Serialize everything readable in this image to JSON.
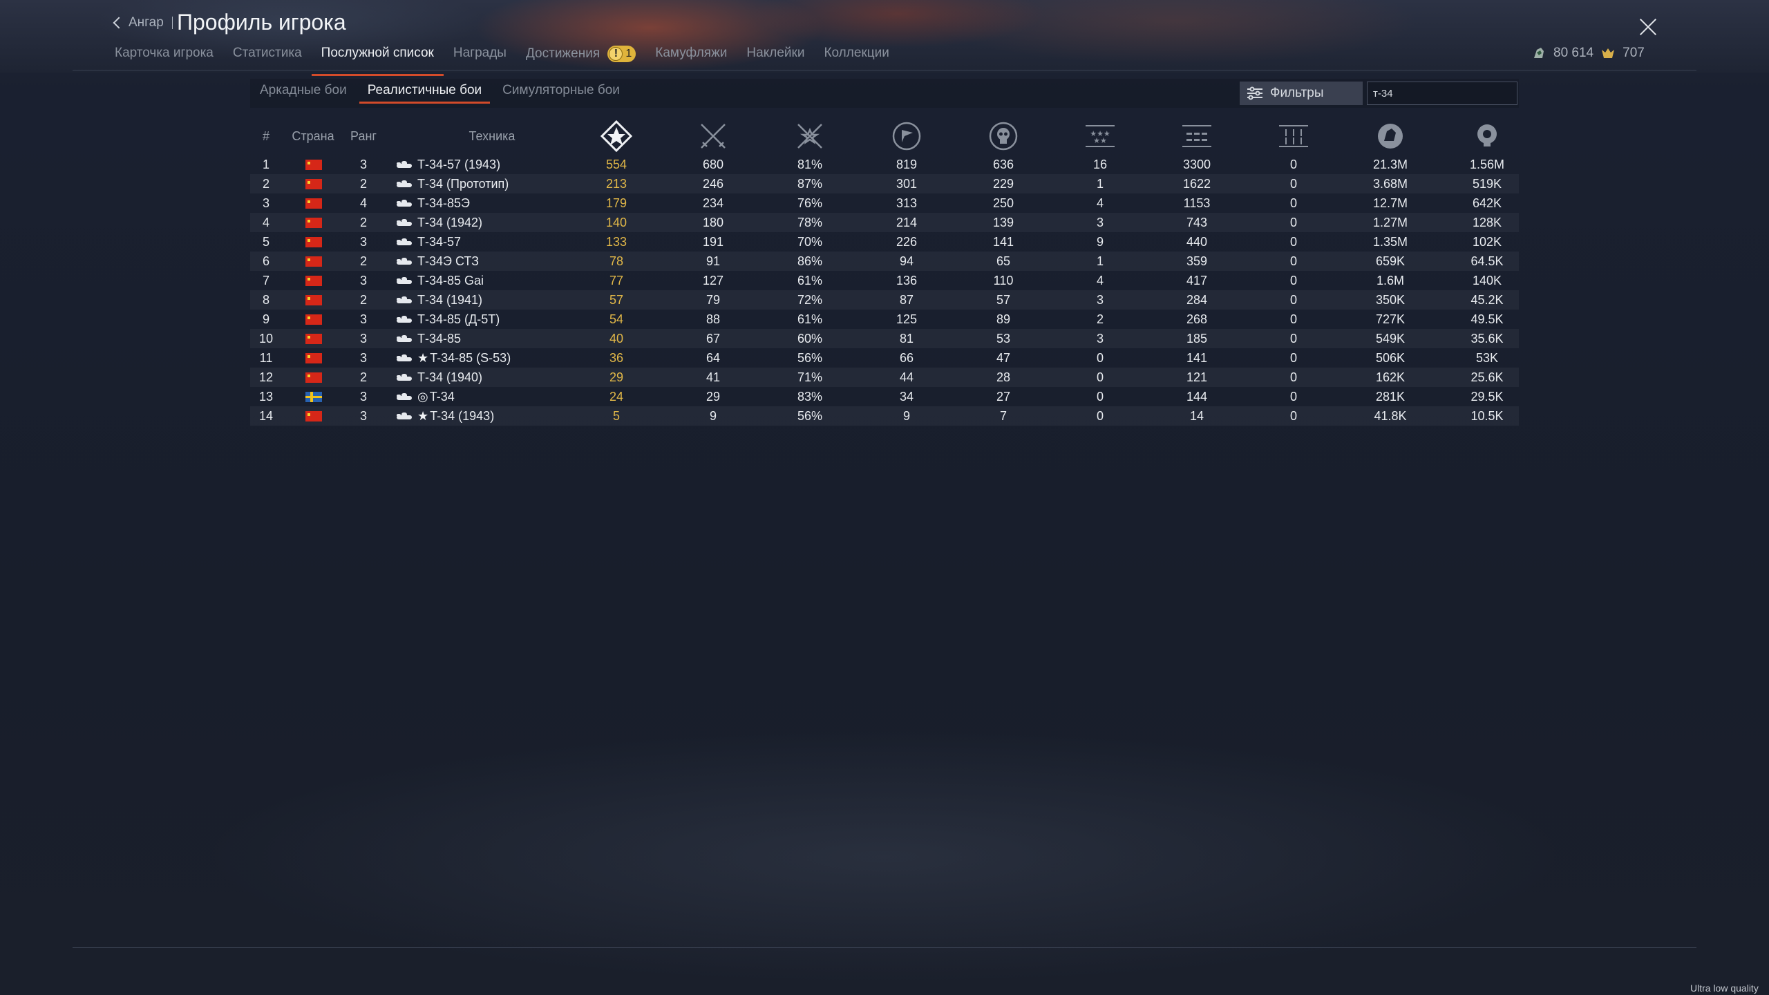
{
  "header": {
    "back_label": "Ангар",
    "title": "Профиль игрока"
  },
  "tabs": [
    {
      "label": "Карточка игрока"
    },
    {
      "label": "Статистика"
    },
    {
      "label": "Послужной список",
      "active": true
    },
    {
      "label": "Награды"
    },
    {
      "label": "Достижения",
      "badge": "1"
    },
    {
      "label": "Камуфляжи"
    },
    {
      "label": "Наклейки"
    },
    {
      "label": "Коллекции"
    }
  ],
  "currency": {
    "silver": "80 614",
    "gold": "707"
  },
  "mode_tabs": [
    {
      "label": "Аркадные бои"
    },
    {
      "label": "Реалистичные бои",
      "active": true
    },
    {
      "label": "Симуляторные бои"
    }
  ],
  "filter": {
    "label": "Фильтры",
    "search_value": "т-34"
  },
  "columns": {
    "num": "#",
    "country": "Страна",
    "rank": "Ранг",
    "vehicle": "Техника",
    "stat_icons": [
      "victories-icon",
      "battles-icon",
      "win-rate-icon",
      "respawns-icon",
      "deaths-icon",
      "air-kills-icon",
      "ground-kills-icon",
      "naval-kills-icon",
      "silver-earned-icon",
      "research-earned-icon"
    ]
  },
  "rows": [
    {
      "num": "1",
      "country": "ussr",
      "rank": "3",
      "prefix": "",
      "vehicle": "Т-34-57 (1943)",
      "stats": [
        "554",
        "680",
        "81%",
        "819",
        "636",
        "16",
        "3300",
        "0",
        "21.3M",
        "1.56M"
      ]
    },
    {
      "num": "2",
      "country": "ussr",
      "rank": "2",
      "prefix": "",
      "vehicle": "Т-34 (Прототип)",
      "stats": [
        "213",
        "246",
        "87%",
        "301",
        "229",
        "1",
        "1622",
        "0",
        "3.68M",
        "519K"
      ]
    },
    {
      "num": "3",
      "country": "ussr",
      "rank": "4",
      "prefix": "",
      "vehicle": "Т-34-85Э",
      "stats": [
        "179",
        "234",
        "76%",
        "313",
        "250",
        "4",
        "1153",
        "0",
        "12.7M",
        "642K"
      ]
    },
    {
      "num": "4",
      "country": "ussr",
      "rank": "2",
      "prefix": "",
      "vehicle": "Т-34 (1942)",
      "stats": [
        "140",
        "180",
        "78%",
        "214",
        "139",
        "3",
        "743",
        "0",
        "1.27M",
        "128K"
      ]
    },
    {
      "num": "5",
      "country": "ussr",
      "rank": "3",
      "prefix": "",
      "vehicle": "Т-34-57",
      "stats": [
        "133",
        "191",
        "70%",
        "226",
        "141",
        "9",
        "440",
        "0",
        "1.35M",
        "102K"
      ]
    },
    {
      "num": "6",
      "country": "ussr",
      "rank": "2",
      "prefix": "",
      "vehicle": "Т-34Э СТЗ",
      "stats": [
        "78",
        "91",
        "86%",
        "94",
        "65",
        "1",
        "359",
        "0",
        "659K",
        "64.5K"
      ]
    },
    {
      "num": "7",
      "country": "china",
      "rank": "3",
      "prefix": "",
      "vehicle": "Т-34-85 Gai",
      "stats": [
        "77",
        "127",
        "61%",
        "136",
        "110",
        "4",
        "417",
        "0",
        "1.6M",
        "140K"
      ]
    },
    {
      "num": "8",
      "country": "ussr",
      "rank": "2",
      "prefix": "",
      "vehicle": "Т-34 (1941)",
      "stats": [
        "57",
        "79",
        "72%",
        "87",
        "57",
        "3",
        "284",
        "0",
        "350K",
        "45.2K"
      ]
    },
    {
      "num": "9",
      "country": "ussr",
      "rank": "3",
      "prefix": "",
      "vehicle": "Т-34-85 (Д-5Т)",
      "stats": [
        "54",
        "88",
        "61%",
        "125",
        "89",
        "2",
        "268",
        "0",
        "727K",
        "49.5K"
      ]
    },
    {
      "num": "10",
      "country": "ussr",
      "rank": "3",
      "prefix": "",
      "vehicle": "Т-34-85",
      "stats": [
        "40",
        "67",
        "60%",
        "81",
        "53",
        "3",
        "185",
        "0",
        "549K",
        "35.6K"
      ]
    },
    {
      "num": "11",
      "country": "china",
      "rank": "3",
      "prefix": "★",
      "vehicle": "T-34-85 (S-53)",
      "stats": [
        "36",
        "64",
        "56%",
        "66",
        "47",
        "0",
        "141",
        "0",
        "506K",
        "53K"
      ]
    },
    {
      "num": "12",
      "country": "ussr",
      "rank": "2",
      "prefix": "",
      "vehicle": "Т-34 (1940)",
      "stats": [
        "29",
        "41",
        "71%",
        "44",
        "28",
        "0",
        "121",
        "0",
        "162K",
        "25.6K"
      ]
    },
    {
      "num": "13",
      "country": "sweden",
      "rank": "3",
      "prefix": "◎",
      "vehicle": "T-34",
      "stats": [
        "24",
        "29",
        "83%",
        "34",
        "27",
        "0",
        "144",
        "0",
        "281K",
        "29.5K"
      ]
    },
    {
      "num": "14",
      "country": "china",
      "rank": "3",
      "prefix": "★",
      "vehicle": "T-34 (1943)",
      "stats": [
        "5",
        "9",
        "56%",
        "9",
        "7",
        "0",
        "14",
        "0",
        "41.8K",
        "10.5K"
      ]
    }
  ],
  "footer": {
    "quality": "Ultra low quality"
  }
}
